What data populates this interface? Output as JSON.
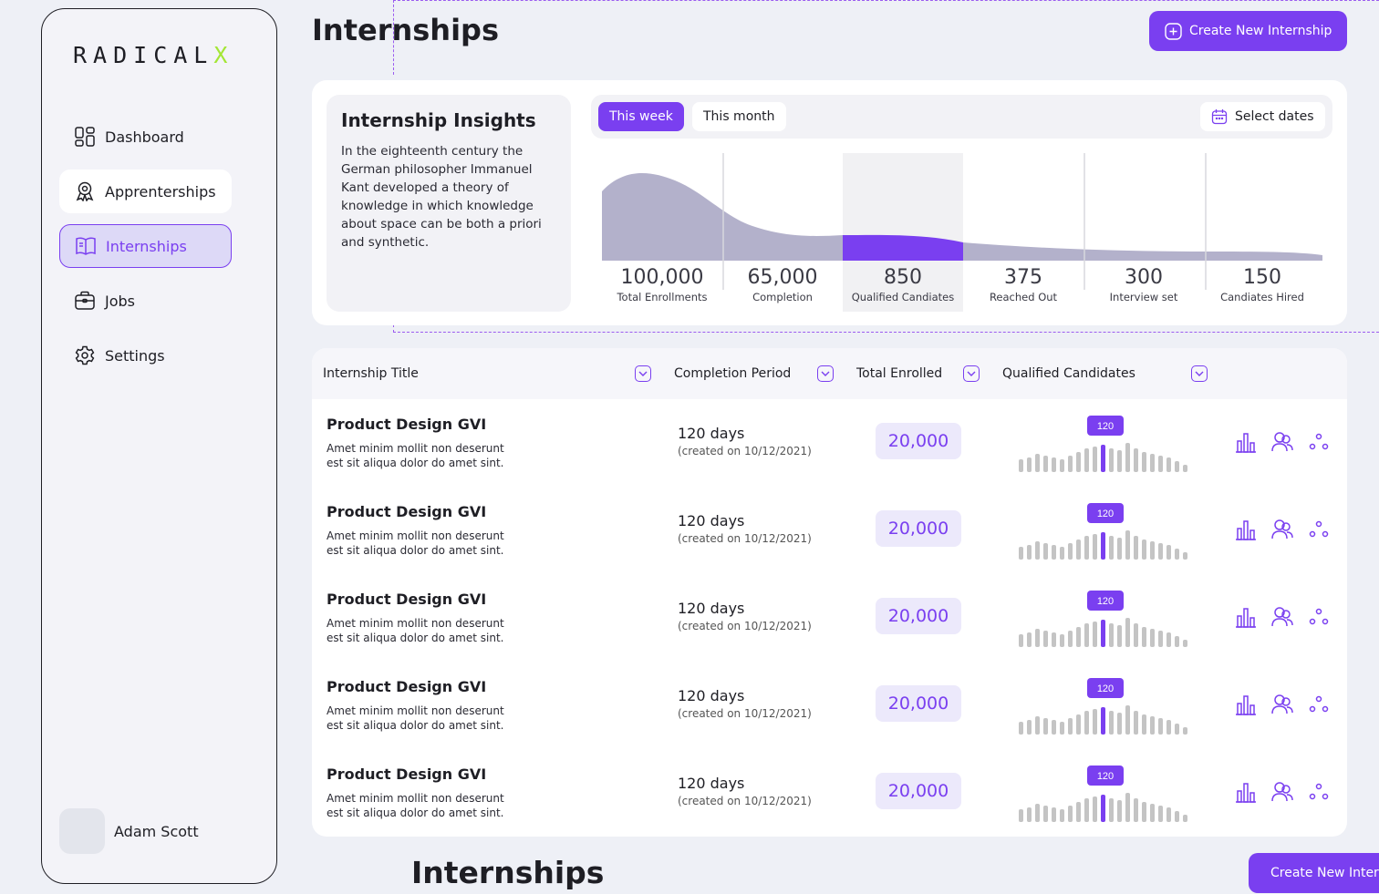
{
  "app": {
    "logo_main": "RADICAL",
    "logo_x": "X"
  },
  "sidebar": {
    "items": [
      {
        "label": "Dashboard",
        "icon": "dashboard-icon"
      },
      {
        "label": "Apprenterships",
        "icon": "award-icon"
      },
      {
        "label": "Internships",
        "icon": "book-icon"
      },
      {
        "label": "Jobs",
        "icon": "briefcase-icon"
      },
      {
        "label": "Settings",
        "icon": "gear-icon"
      }
    ],
    "user": {
      "name": "Adam Scott"
    }
  },
  "header": {
    "title": "Internships",
    "create_label": "Create New Internship"
  },
  "insights": {
    "title": "Internship Insights",
    "description": "In the eighteenth century the German philosopher Immanuel Kant developed a theory of knowledge in which knowledge about space can be both a priori and synthetic.",
    "filters": {
      "week": "This week",
      "month": "This month",
      "dates": "Select dates"
    },
    "stats": [
      {
        "value": "100,000",
        "label": "Total Enrollments"
      },
      {
        "value": "65,000",
        "label": "Completion"
      },
      {
        "value": "850",
        "label": "Qualified Candiates"
      },
      {
        "value": "375",
        "label": "Reached Out"
      },
      {
        "value": "300",
        "label": "Interview set"
      },
      {
        "value": "150",
        "label": "Candiates Hired"
      }
    ]
  },
  "table": {
    "headers": {
      "title": "Internship Title",
      "period": "Completion Period",
      "enrolled": "Total Enrolled",
      "qualified": "Qualified Candidates"
    },
    "rows": [
      {
        "title": "Product Design GVI",
        "desc": "Amet minim mollit non deserunt est sit aliqua dolor do amet sint.",
        "days": "120 days",
        "created": "(created on 10/12/2021)",
        "enrolled": "20,000",
        "badge": "120"
      },
      {
        "title": "Product Design GVI",
        "desc": "Amet minim mollit non deserunt est sit aliqua dolor do amet sint.",
        "days": "120 days",
        "created": "(created on 10/12/2021)",
        "enrolled": "20,000",
        "badge": "120"
      },
      {
        "title": "Product Design GVI",
        "desc": "Amet minim mollit non deserunt est sit aliqua dolor do amet sint.",
        "days": "120 days",
        "created": "(created on 10/12/2021)",
        "enrolled": "20,000",
        "badge": "120"
      },
      {
        "title": "Product Design GVI",
        "desc": "Amet minim mollit non deserunt est sit aliqua dolor do amet sint.",
        "days": "120 days",
        "created": "(created on 10/12/2021)",
        "enrolled": "20,000",
        "badge": "120"
      },
      {
        "title": "Product Design GVI",
        "desc": "Amet minim mollit non deserunt est sit aliqua dolor do amet sint.",
        "days": "120 days",
        "created": "(created on 10/12/2021)",
        "enrolled": "20,000",
        "badge": "120"
      }
    ]
  },
  "bottom": {
    "title": "Internships",
    "create_label": "Create New Internship"
  },
  "colors": {
    "accent": "#7a3ff0",
    "accent_soft": "#ece9fb",
    "funnel": "#b3b1cb",
    "bar": "#c4c4c4",
    "logo_x": "#a3e635"
  }
}
